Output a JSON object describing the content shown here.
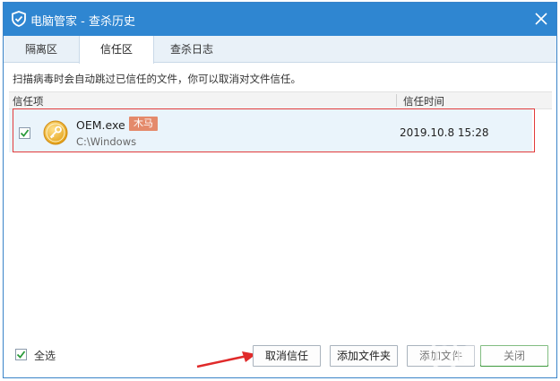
{
  "window": {
    "title": "电脑管家 - 查杀历史"
  },
  "tabs": [
    {
      "label": "隔离区",
      "active": false
    },
    {
      "label": "信任区",
      "active": true
    },
    {
      "label": "查杀日志",
      "active": false
    }
  ],
  "hint": "扫描病毒时会自动跳过已信任的文件，你可以取消对文件信任。",
  "columns": {
    "item": "信任项",
    "time": "信任时间"
  },
  "rows": [
    {
      "name": "OEM.exe",
      "badge": "木马",
      "path": "C:\\Windows",
      "time": "2019.10.8 15:28",
      "checked": true
    }
  ],
  "footer": {
    "select_all": "全选",
    "select_all_checked": true,
    "buttons": {
      "cancel_trust": "取消信任",
      "add_folder": "添加文件夹",
      "add_file": "添加文件",
      "close": "关闭"
    }
  },
  "colors": {
    "titlebar": "#2f86d1",
    "badge": "#e48a6b",
    "highlight": "#e23b3b",
    "row": "#eaf4fb"
  }
}
